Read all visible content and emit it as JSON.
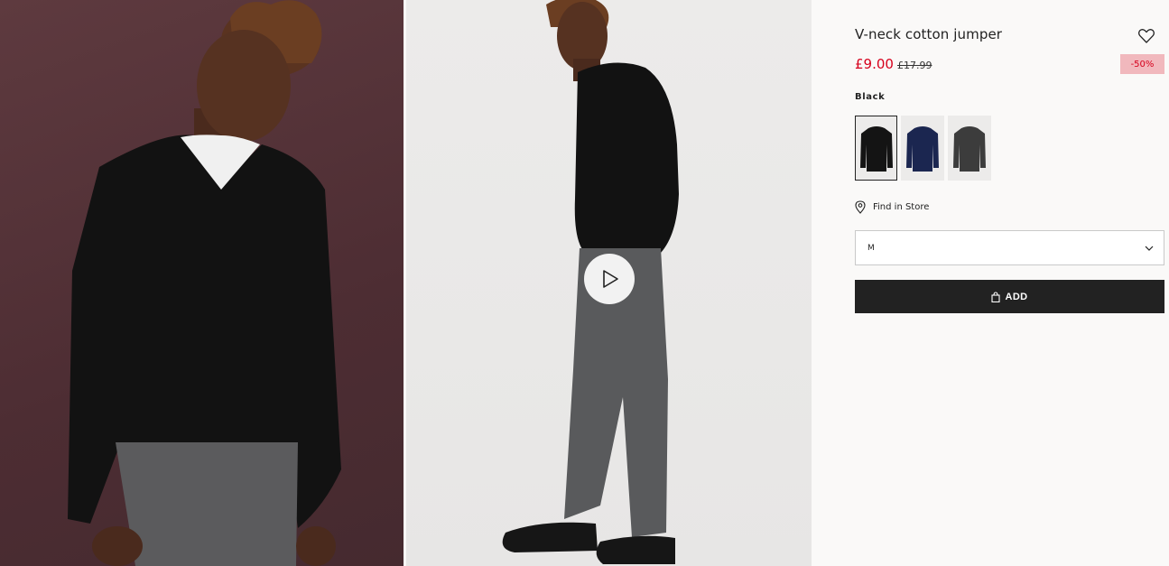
{
  "product": {
    "title": "V-neck cotton jumper",
    "price_now": "£9.00",
    "price_old": "£17.99",
    "discount_badge": "-50%"
  },
  "colors": {
    "selected_label": "Black",
    "swatches": [
      {
        "name": "black",
        "hex": "#141414",
        "selected": true
      },
      {
        "name": "navy",
        "hex": "#1b2650",
        "selected": false
      },
      {
        "name": "dark-grey",
        "hex": "#3c3c3c",
        "selected": false
      }
    ]
  },
  "store": {
    "label": "Find in Store",
    "icon": "location-pin-icon"
  },
  "size": {
    "value": "M",
    "icon": "chevron-down-icon"
  },
  "cart": {
    "add_label": "ADD",
    "icon": "shopping-bag-icon"
  },
  "gallery": {
    "images": [
      {
        "name": "model-front-photo",
        "background": "#573439"
      },
      {
        "name": "model-side-photo",
        "background": "#eae9e8"
      }
    ],
    "play_icon": "play-icon"
  },
  "accent_colors": {
    "sale": "#d6001c",
    "button": "#222222",
    "badge_bg": "#f1b8bd"
  }
}
